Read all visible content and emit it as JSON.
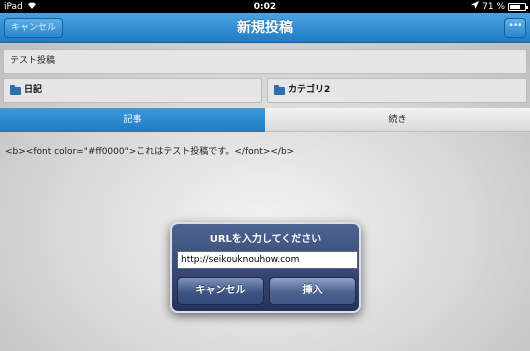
{
  "status_bar": {
    "device": "iPad",
    "time": "0:02",
    "battery_text": "71 %",
    "battery_level": 0.71
  },
  "nav": {
    "title": "新規投稿",
    "cancel_label": "キャンセル",
    "more_label": "•••"
  },
  "form": {
    "title_value": "テスト投稿",
    "diary_label": "日記",
    "category_label": "カテゴリ2"
  },
  "tabs": [
    {
      "label": "記事",
      "active": true
    },
    {
      "label": "続き",
      "active": false
    }
  ],
  "editor": {
    "body": "<b><font color=\"#ff0000\">これはテスト投稿です。</font></b>"
  },
  "alert": {
    "title": "URLを入力してください",
    "input_value": "http://seikouknouhow.com",
    "cancel_label": "キャンセル",
    "insert_label": "挿入"
  },
  "colors": {
    "accent": "#1f7cc4"
  }
}
